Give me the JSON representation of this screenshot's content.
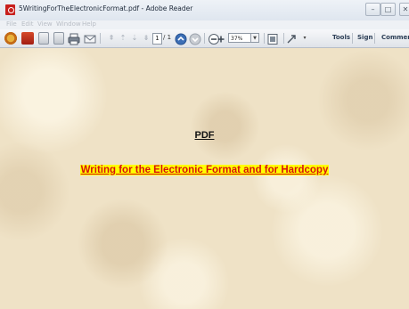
{
  "window": {
    "title": "5WritingForTheElectronicFormat.pdf - Adobe Reader",
    "controls": [
      "minimize-icon",
      "maximize-icon",
      "close-icon"
    ]
  },
  "menubar": {
    "items": [
      "File",
      "Edit",
      "View",
      "Window",
      "Help"
    ]
  },
  "toolbar": {
    "icons": [
      "create-pdf-icon",
      "open-icon",
      "edit-icon",
      "save-icon",
      "print-icon",
      "email-icon",
      "first-page-icon",
      "previous-page-icon",
      "next-page-icon",
      "last-page-icon",
      "page-up-icon",
      "page-down-icon",
      "zoom-out-icon",
      "zoom-in-icon",
      "fit-page-icon",
      "fullscreen-icon",
      "customize-icon"
    ],
    "current_page": "1",
    "page_total": "/ 1",
    "zoom": "37%",
    "tools_label": "Tools",
    "sign_label": "Sign",
    "comment_label": "Comment"
  },
  "document": {
    "heading": "PDF",
    "title": "Writing for the Electronic Format and for Hardcopy"
  },
  "colors": {
    "title_text": "#d8120d",
    "title_highlight": "#ffff00",
    "page_background": "#efe2c6"
  }
}
